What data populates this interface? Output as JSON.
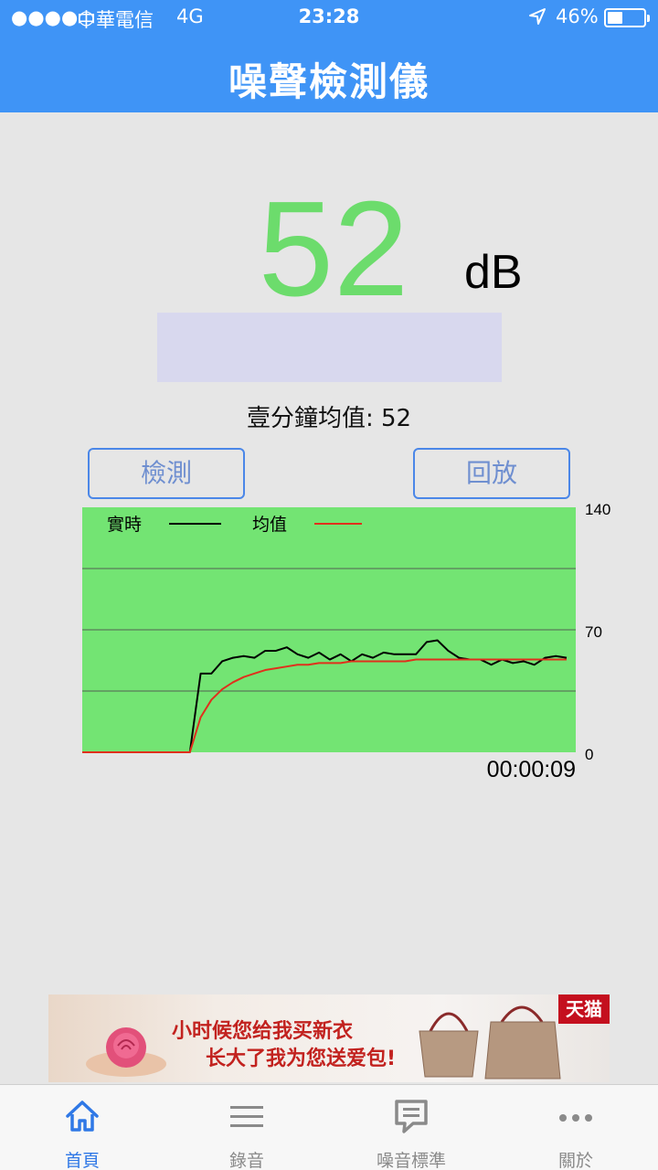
{
  "status_bar": {
    "signal": "●●●●○",
    "carrier": "中華電信",
    "network": "4G",
    "time": "23:28",
    "battery": "46%"
  },
  "header": {
    "title": "噪聲檢測儀"
  },
  "reading": {
    "value": "52",
    "unit": "dB",
    "avg_label": "壹分鐘均值: 52"
  },
  "buttons": {
    "detect": "檢測",
    "replay": "回放"
  },
  "chart_data": {
    "type": "line",
    "legend": [
      "實時",
      "均值"
    ],
    "y_ticks": [
      "140",
      "70",
      "0"
    ],
    "ylim": [
      0,
      140
    ],
    "x": [
      0,
      1,
      2,
      3,
      4,
      5,
      6,
      7,
      8,
      9,
      10,
      11,
      12,
      13,
      14,
      15,
      16,
      17,
      18,
      19,
      20,
      21,
      22,
      23,
      24,
      25,
      26,
      27,
      28,
      29,
      30,
      31,
      32,
      33,
      34,
      35,
      36,
      37,
      38,
      39,
      40,
      41,
      42,
      43,
      44,
      45
    ],
    "series": [
      {
        "name": "實時",
        "color": "#000000",
        "values": [
          0,
          0,
          0,
          0,
          0,
          0,
          0,
          0,
          0,
          0,
          0,
          45,
          45,
          52,
          54,
          55,
          54,
          58,
          58,
          60,
          56,
          54,
          57,
          53,
          56,
          52,
          56,
          54,
          57,
          56,
          56,
          56,
          63,
          64,
          58,
          54,
          53,
          53,
          50,
          53,
          51,
          52,
          50,
          54,
          55,
          54
        ]
      },
      {
        "name": "均值",
        "color": "#e0301c",
        "values": [
          0,
          0,
          0,
          0,
          0,
          0,
          0,
          0,
          0,
          0,
          0,
          20,
          30,
          36,
          40,
          43,
          45,
          47,
          48,
          49,
          50,
          50,
          51,
          51,
          51,
          52,
          52,
          52,
          52,
          52,
          52,
          53,
          53,
          53,
          53,
          53,
          53,
          53,
          53,
          53,
          53,
          53,
          53,
          53,
          53,
          53
        ]
      }
    ],
    "time_display": "00:00:09"
  },
  "ad": {
    "line1": "小时候您给我买新衣",
    "line2": "长大了我为您送爱包!",
    "badge": "天猫"
  },
  "tabs": [
    {
      "label": "首頁",
      "icon": "home-icon"
    },
    {
      "label": "錄音",
      "icon": "menu-lines-icon"
    },
    {
      "label": "噪音標準",
      "icon": "chat-bubble-icon"
    },
    {
      "label": "關於",
      "icon": "more-dots-icon"
    }
  ]
}
